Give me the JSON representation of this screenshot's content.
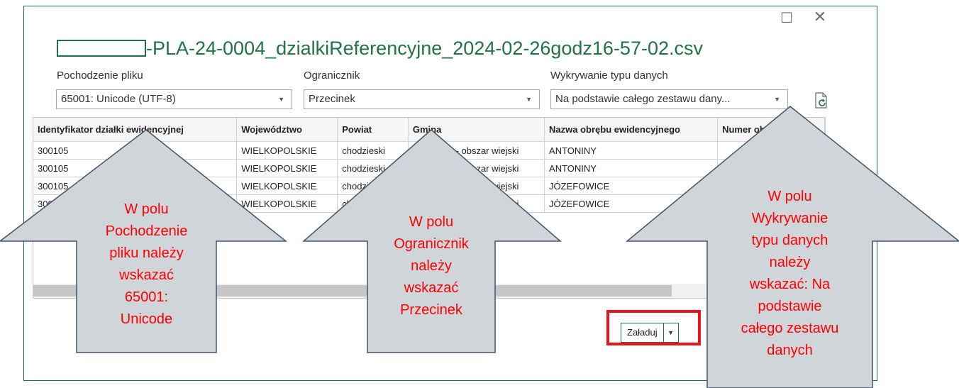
{
  "window": {
    "title": "-PLA-24-0004_dzialkiReferencyjne_2024-02-26godz16-57-02.csv",
    "maximize_icon": "☐",
    "close_icon": "✕"
  },
  "fields": {
    "origin": {
      "label": "Pochodzenie pliku",
      "value": "65001: Unicode (UTF-8)"
    },
    "delimiter": {
      "label": "Ogranicznik",
      "value": "Przecinek"
    },
    "detection": {
      "label": "Wykrywanie typu danych",
      "value": "Na podstawie całego zestawu dany..."
    }
  },
  "table": {
    "headers": [
      "Identyfikator działki ewidencyjnej",
      "Województwo",
      "Powiat",
      "Gmina",
      "Nazwa obrębu ewidencyjnego",
      "Numer obrębu ewid"
    ],
    "rows": [
      [
        "300105",
        "WIELKOPOLSKIE",
        "chodzieski",
        "Szamocin - obszar wiejski",
        "ANTONINY",
        ""
      ],
      [
        "300105",
        "WIELKOPOLSKIE",
        "chodzieski",
        "Szamocin - obszar wiejski",
        "ANTONINY",
        ""
      ],
      [
        "300105",
        "WIELKOPOLSKIE",
        "chodzieski",
        "Szamocin - obszar wiejski",
        "JÓZEFOWICE",
        ""
      ],
      [
        "300105",
        "WIELKOPOLSKIE",
        "chodzieski",
        "Szamocin - obszar wiejski",
        "JÓZEFOWICE",
        ""
      ]
    ]
  },
  "buttons": {
    "load": "Załaduj",
    "dropdown_icon": "▼"
  },
  "callouts": {
    "left": [
      "W polu",
      "Pochodzenie",
      "pliku należy",
      "wskazać",
      "65001:",
      "Unicode"
    ],
    "middle": [
      "W polu",
      "Ogranicznik",
      "należy",
      "wskazać",
      "Przecinek"
    ],
    "right": [
      "W polu",
      "Wykrywanie",
      "typu danych",
      "należy",
      "wskazać: Na",
      "podstawie",
      "całego zestawu",
      "danych"
    ]
  },
  "colors": {
    "accent": "#217346",
    "callout_text": "#ff0000",
    "arrow_fill": "#d0d5d9",
    "highlight_border": "#e8141e"
  }
}
